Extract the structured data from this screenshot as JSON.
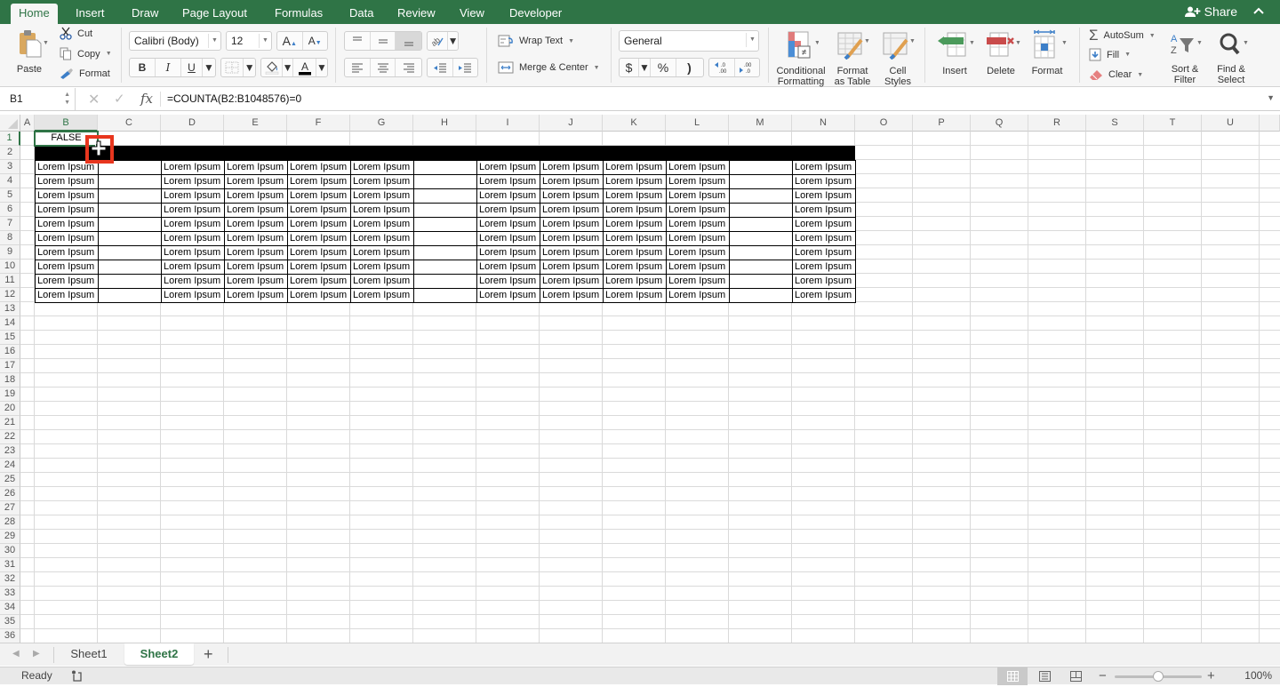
{
  "ribbon_tabs": [
    {
      "label": "Home",
      "active": true
    },
    {
      "label": "Insert",
      "active": false
    },
    {
      "label": "Draw",
      "active": false
    },
    {
      "label": "Page Layout",
      "active": false
    },
    {
      "label": "Formulas",
      "active": false
    },
    {
      "label": "Data",
      "active": false
    },
    {
      "label": "Review",
      "active": false
    },
    {
      "label": "View",
      "active": false
    },
    {
      "label": "Developer",
      "active": false
    }
  ],
  "share_label": "Share",
  "colors": {
    "brand_green": "#2f7446",
    "highlight_red": "#e8361e"
  },
  "clipboard": {
    "paste": "Paste",
    "cut": "Cut",
    "copy": "Copy",
    "format": "Format"
  },
  "font": {
    "name": "Calibri (Body)",
    "size": "12",
    "bold": "B",
    "italic": "I",
    "underline": "U"
  },
  "alignment": {
    "wrap_text": "Wrap Text",
    "merge_center": "Merge & Center"
  },
  "number": {
    "format": "General",
    "currency": "$",
    "percent": "%",
    "comma": ")",
    "inc_decimal": "←.0 .00",
    "dec_decimal": ".00 →.0"
  },
  "styles": {
    "conditional_formatting": [
      "Conditional",
      "Formatting"
    ],
    "format_as_table": [
      "Format",
      "as Table"
    ],
    "cell_styles": [
      "Cell",
      "Styles"
    ]
  },
  "cells_group": {
    "insert": "Insert",
    "delete": "Delete",
    "format": "Format"
  },
  "editing": {
    "autosum": "AutoSum",
    "fill": "Fill",
    "clear": "Clear",
    "sort_filter": [
      "Sort &",
      "Filter"
    ],
    "find_select": [
      "Find &",
      "Select"
    ]
  },
  "formula_bar": {
    "name_box": "B1",
    "fx": "fx",
    "formula": "=COUNTA(B2:B1048576)=0"
  },
  "columns": [
    "A",
    "B",
    "C",
    "D",
    "E",
    "F",
    "G",
    "H",
    "I",
    "J",
    "K",
    "L",
    "M",
    "N",
    "O",
    "P",
    "Q",
    "R",
    "S",
    "T",
    "U"
  ],
  "rows": [
    "1",
    "2",
    "3",
    "4",
    "5",
    "6",
    "7",
    "8",
    "9",
    "10",
    "11",
    "12",
    "13",
    "14",
    "15",
    "16",
    "17",
    "18",
    "19",
    "20",
    "21",
    "22",
    "23",
    "24",
    "25",
    "26",
    "27",
    "28",
    "29",
    "30",
    "31",
    "32",
    "33",
    "34",
    "35",
    "36"
  ],
  "selected_cell": {
    "column": "B",
    "row": "1",
    "value": "FALSE"
  },
  "table": {
    "filled_columns": [
      "B",
      "D",
      "E",
      "F",
      "G",
      "I",
      "J",
      "K",
      "L",
      "N"
    ],
    "empty_bordered_columns": [
      "C",
      "H",
      "M"
    ],
    "header_row_black": "2",
    "data_rows": [
      "3",
      "4",
      "5",
      "6",
      "7",
      "8",
      "9",
      "10",
      "11",
      "12"
    ],
    "cell_text": "Lorem Ipsum"
  },
  "sheets": [
    {
      "label": "Sheet1",
      "active": false
    },
    {
      "label": "Sheet2",
      "active": true
    }
  ],
  "add_sheet": "+",
  "status": {
    "text": "Ready",
    "zoom": "100%",
    "zoom_fraction": 0.5
  }
}
